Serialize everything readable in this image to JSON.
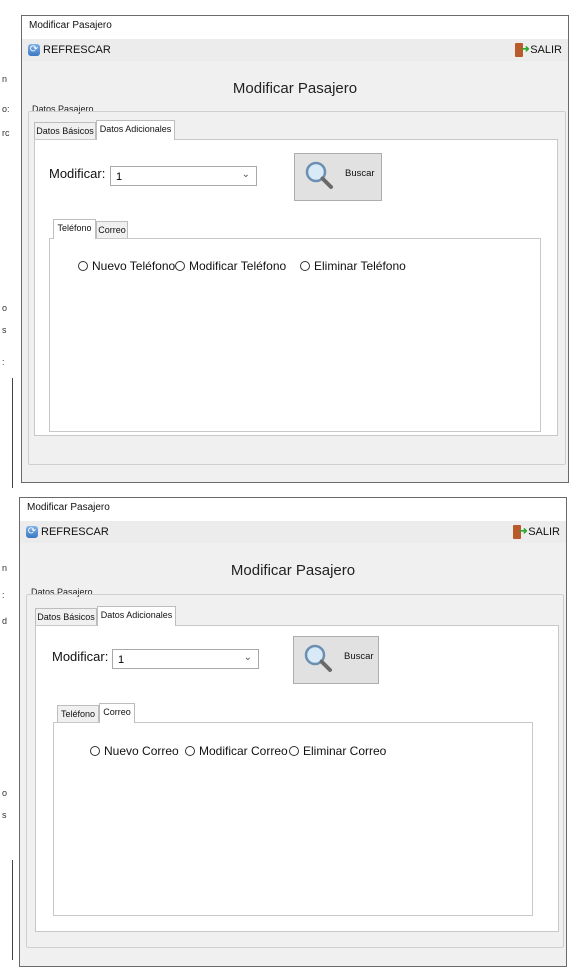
{
  "window": {
    "title": "Modificar Pasajero",
    "refresh_label": "REFRESCAR",
    "exit_label": "SALIR",
    "heading": "Modificar Pasajero",
    "group_label": "Datos Pasajero"
  },
  "main_tabs": [
    "Datos Básicos",
    "Datos Adicionales"
  ],
  "search": {
    "label": "Modificar:",
    "selected_value": "1",
    "button_label": "Buscar"
  },
  "sub_tabs": [
    "Teléfono",
    "Correo"
  ],
  "telefono_options": [
    "Nuevo Teléfono",
    "Modificar Teléfono",
    "Eliminar Teléfono"
  ],
  "correo_options": [
    "Nuevo Correo",
    "Modificar Correo",
    "Eliminar Correo"
  ],
  "background_fragments": {
    "top": [
      "n",
      "o:",
      "rc",
      "o",
      "s",
      ":"
    ],
    "bottom": [
      "n",
      ":",
      "d",
      "o",
      "s"
    ]
  },
  "colors": {
    "window_bg": "#f0f0f0",
    "panel_bg": "#ffffff",
    "refresh_icon": "#3a78c2",
    "exit_door": "#b85a2a",
    "exit_arrow": "#2fa82f"
  },
  "icons": [
    "refresh-icon",
    "exit-icon",
    "magnifier-icon",
    "chevron-down-icon",
    "radio-icon"
  ]
}
